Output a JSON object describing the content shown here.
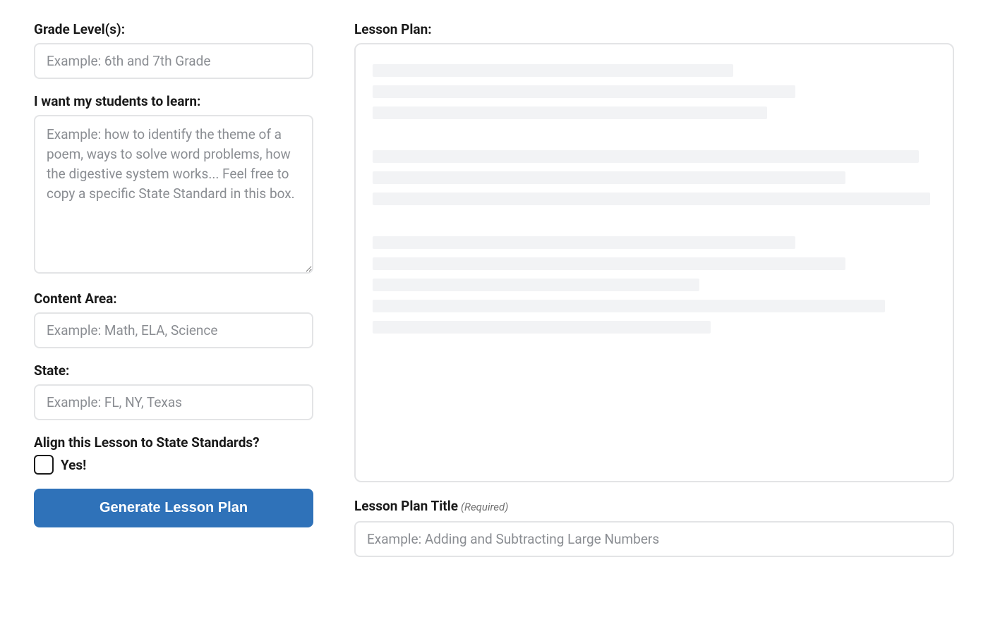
{
  "form": {
    "grade_level": {
      "label": "Grade Level(s):",
      "placeholder": "Example: 6th and 7th Grade",
      "value": ""
    },
    "learn": {
      "label": "I want my students to learn:",
      "placeholder": "Example: how to identify the theme of a poem, ways to solve word problems, how the digestive system works... Feel free to copy a specific State Standard in this box.",
      "value": ""
    },
    "content_area": {
      "label": "Content Area:",
      "placeholder": "Example: Math, ELA, Science",
      "value": ""
    },
    "state": {
      "label": "State:",
      "placeholder": "Example: FL, NY, Texas",
      "value": ""
    },
    "align_standards": {
      "label": "Align this Lesson to State Standards?",
      "option_label": "Yes!",
      "checked": false
    },
    "submit_label": "Generate Lesson Plan"
  },
  "output": {
    "heading": "Lesson Plan:",
    "title_field": {
      "label": "Lesson Plan Title",
      "hint": "(Required)",
      "placeholder": "Example: Adding and Subtracting Large Numbers",
      "value": ""
    }
  }
}
